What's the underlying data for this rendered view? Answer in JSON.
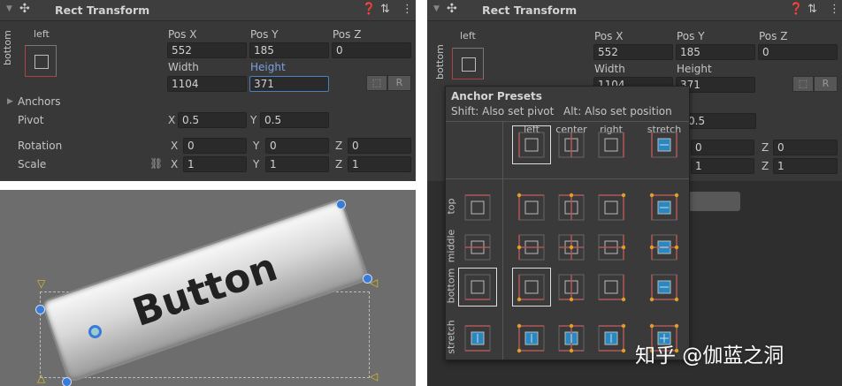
{
  "component_title": "Rect Transform",
  "anchor_labels": {
    "h": "left",
    "v": "bottom"
  },
  "fields": {
    "pos_x": {
      "label": "Pos X",
      "value": "552"
    },
    "pos_y": {
      "label": "Pos Y",
      "value": "185"
    },
    "pos_z": {
      "label": "Pos Z",
      "value": "0"
    },
    "width": {
      "label": "Width",
      "value": "1104"
    },
    "height": {
      "label": "Height",
      "value": "371"
    }
  },
  "blueprint_button": "R",
  "anchors_label": "Anchors",
  "pivot": {
    "label": "Pivot",
    "x": "0.5",
    "y": "0.5"
  },
  "rotation": {
    "label": "Rotation",
    "x": "0",
    "y": "0",
    "z": "0"
  },
  "scale": {
    "label": "Scale",
    "x": "1",
    "y": "1",
    "z": "1"
  },
  "axis": {
    "x": "X",
    "y": "Y",
    "z": "Z"
  },
  "scene": {
    "button_text": "Button"
  },
  "presets": {
    "title": "Anchor Presets",
    "shift_hint": "Shift: Also set pivot",
    "alt_hint": "Alt: Also set position",
    "columns": [
      "left",
      "center",
      "right",
      "stretch"
    ],
    "rows": [
      "top",
      "middle",
      "bottom",
      "stretch"
    ],
    "selected": {
      "h": "left",
      "v": "bottom"
    }
  },
  "colors": {
    "anchor_line": "#b0585a",
    "dot": "#e0a020",
    "stretch_fill": "#2a88c0"
  },
  "watermark": "知乎 @伽蓝之洞"
}
